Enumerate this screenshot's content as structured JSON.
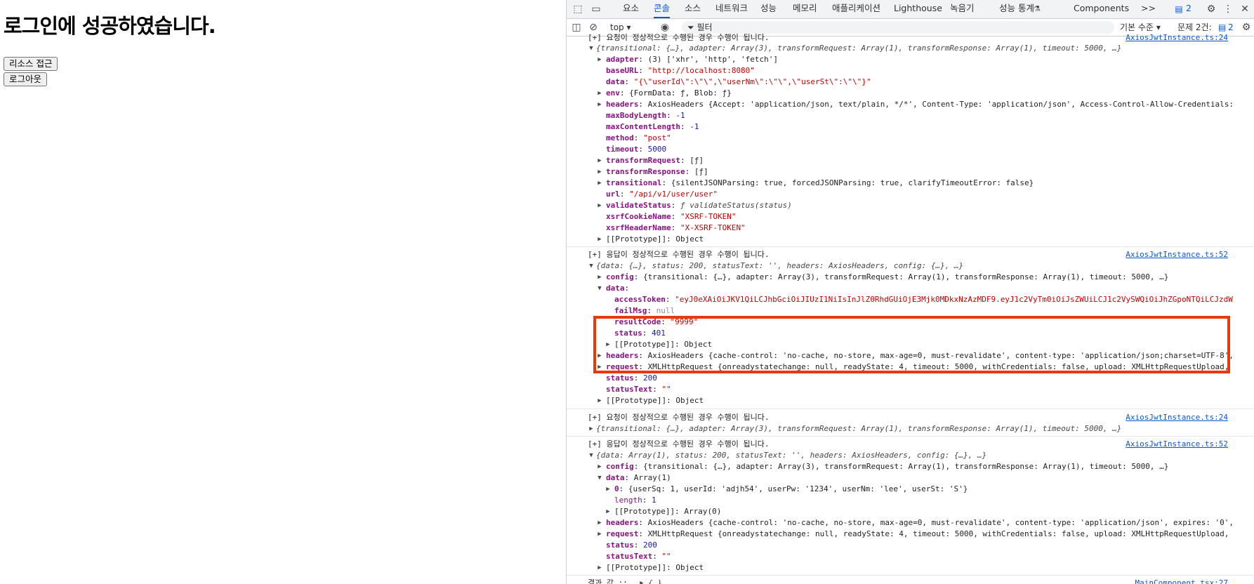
{
  "page": {
    "heading": "로그인에 성공하였습니다.",
    "resource_button": "리소스 접근",
    "logout_button": "로그아웃"
  },
  "devtools": {
    "tabs": [
      "요소",
      "콘솔",
      "소스",
      "네트워크",
      "성능",
      "메모리",
      "애플리케이션",
      "Lighthouse",
      "녹음기",
      "성능 통계",
      "Components"
    ],
    "active_tab": "콘솔",
    "more_tabs": ">>",
    "issues_count": "2",
    "context": "top",
    "filter_placeholder": "필터",
    "level": "기본 수준",
    "issues_label": "문제 2건:",
    "issues_badge": "2"
  },
  "console": {
    "messages": [
      {
        "text": "[+] 요청이 정상적으로 수행된 경우 수행이 됩니다.",
        "source": "AxiosJwtInstance.ts:24"
      },
      {
        "text": "[+] 응답이 정상적으로 수행된 경우 수행이 됩니다.",
        "source": "AxiosJwtInstance.ts:52"
      },
      {
        "text": "[+] 요청이 정상적으로 수행된 경우 수행이 됩니다.",
        "source": "AxiosJwtInstance.ts:24"
      },
      {
        "text": "[+] 응답이 정상적으로 수행된 경우 수행이 됩니다.",
        "source": "AxiosJwtInstance.ts:52"
      },
      {
        "text": "결과 값 ::",
        "source": "MainComponent.tsx:27"
      }
    ],
    "req1": {
      "summary": "{transitional: {…}, adapter: Array(3), transformRequest: Array(1), transformResponse: Array(1), timeout: 5000, …}",
      "adapter": "(3) ['xhr', 'http', 'fetch']",
      "baseURL": "\"http://localhost:8080\"",
      "data": "\"{\\\"userId\\\":\\\"\\\",\\\"userNm\\\":\\\"\\\",\\\"userSt\\\":\\\"\\\"}\"",
      "env": "{FormData: ƒ, Blob: ƒ}",
      "headers": "AxiosHeaders {Accept: 'application/json, text/plain, */*', Content-Type: 'application/json', Access-Control-Allow-Credentials:",
      "maxBodyLength": "-1",
      "maxContentLength": "-1",
      "method": "\"post\"",
      "timeout": "5000",
      "transformRequest": "[ƒ]",
      "transformResponse": "[ƒ]",
      "transitional": "{silentJSONParsing: true, forcedJSONParsing: true, clarifyTimeoutError: false}",
      "url": "\"/api/v1/user/user\"",
      "validateStatus": "ƒ validateStatus(status)",
      "xsrfCookieName": "\"XSRF-TOKEN\"",
      "xsrfHeaderName": "\"X-XSRF-TOKEN\"",
      "prototype": "[[Prototype]]: Object"
    },
    "res1": {
      "summary": "{data: {…}, status: 200, statusText: '', headers: AxiosHeaders, config: {…}, …}",
      "config": "{transitional: {…}, adapter: Array(3), transformRequest: Array(1), transformResponse: Array(1), timeout: 5000, …}",
      "accessToken": "\"eyJ0eXAiOiJKV1QiLCJhbGciOiJIUzI1NiIsInJlZ0RhdGUiOjE3Mjk0MDkxNzAzMDF9.eyJ1c2VyTm0iOiJsZWUiLCJ1c2VySWQiOiJhZGpoNTQiLCJzdW",
      "failMsg": "null",
      "resultCode": "\"9999\"",
      "status": "401",
      "data_prototype": "[[Prototype]]: Object",
      "headers": "AxiosHeaders {cache-control: 'no-cache, no-store, max-age=0, must-revalidate', content-type: 'application/json;charset=UTF-8',",
      "request": "XMLHttpRequest {onreadystatechange: null, readyState: 4, timeout: 5000, withCredentials: false, upload: XMLHttpRequestUpload,",
      "http_status": "200",
      "statusText": "\"\"",
      "prototype": "[[Prototype]]: Object"
    },
    "req2": {
      "summary": "{transitional: {…}, adapter: Array(3), transformRequest: Array(1), transformResponse: Array(1), timeout: 5000, …}"
    },
    "res2": {
      "summary": "{data: Array(1), status: 200, statusText: '', headers: AxiosHeaders, config: {…}, …}",
      "config": "{transitional: {…}, adapter: Array(3), transformRequest: Array(1), transformResponse: Array(1), timeout: 5000, …}",
      "data": "Array(1)",
      "item0": "{userSq: 1, userId: 'adjh54', userPw: '1234', userNm: 'lee', userSt: 'S'}",
      "length": "1",
      "data_prototype": "[[Prototype]]: Array(0)",
      "headers": "AxiosHeaders {cache-control: 'no-cache, no-store, max-age=0, must-revalidate', content-type: 'application/json', expires: '0',",
      "request": "XMLHttpRequest {onreadystatechange: null, readyState: 4, timeout: 5000, withCredentials: false, upload: XMLHttpRequestUpload,",
      "http_status": "200",
      "statusText": "\"\"",
      "prototype": "[[Prototype]]: Object"
    },
    "result": "{…}"
  },
  "colors": {
    "highlight": "#e8380d",
    "accent": "#0b57d0"
  }
}
